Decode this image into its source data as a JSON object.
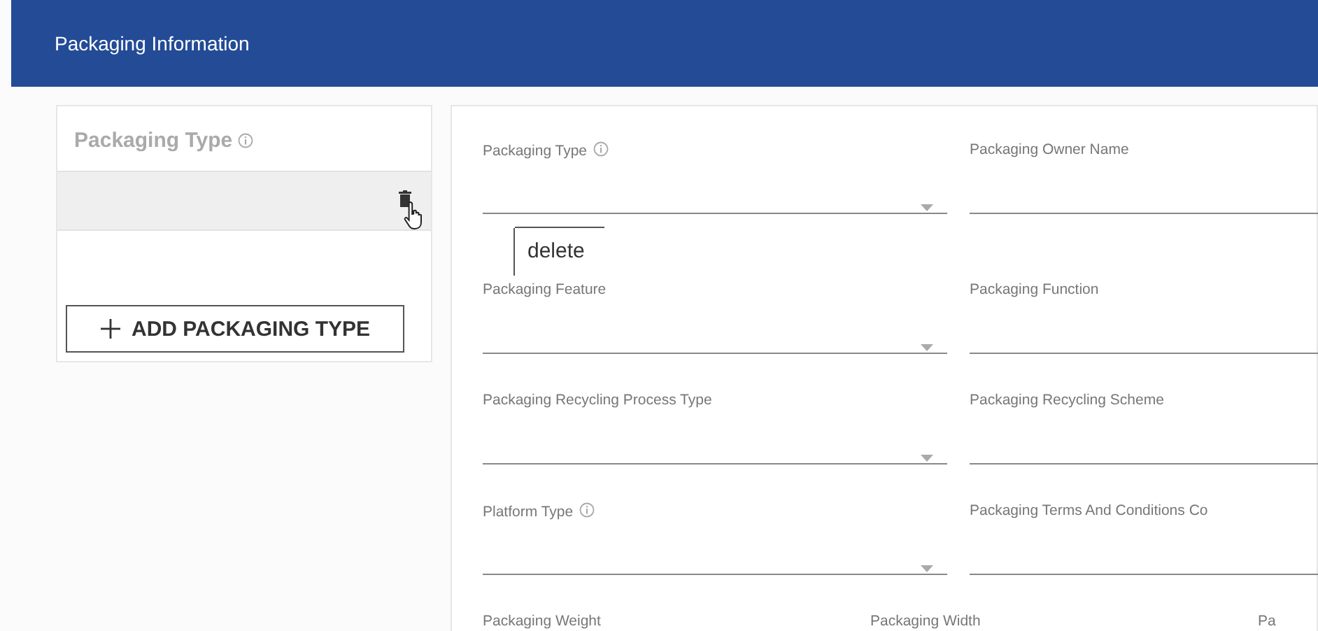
{
  "header": {
    "title": "Packaging Information"
  },
  "left_panel": {
    "title": "Packaging Type",
    "info": true,
    "items": [
      {
        "selected": true,
        "hovered": true
      }
    ],
    "tooltip": "delete",
    "add_button": "ADD PACKAGING TYPE"
  },
  "form": {
    "rows": [
      [
        {
          "label": "Packaging Type",
          "info": true,
          "kind": "select"
        },
        {
          "label": "Packaging Owner Name",
          "kind": "text"
        }
      ],
      [
        {
          "label": "Packaging Feature",
          "kind": "select"
        },
        {
          "label": "Packaging Function",
          "kind": "text"
        }
      ],
      [
        {
          "label": "Packaging Recycling Process Type",
          "kind": "select"
        },
        {
          "label": "Packaging Recycling Scheme",
          "kind": "text"
        }
      ],
      [
        {
          "label": "Platform Type",
          "info": true,
          "kind": "select"
        },
        {
          "label": "Packaging Terms And Conditions Co",
          "kind": "text"
        }
      ],
      [
        {
          "label": "Packaging Weight"
        },
        {
          "label": "Packaging Width"
        },
        {
          "label": "Pa"
        }
      ]
    ]
  }
}
